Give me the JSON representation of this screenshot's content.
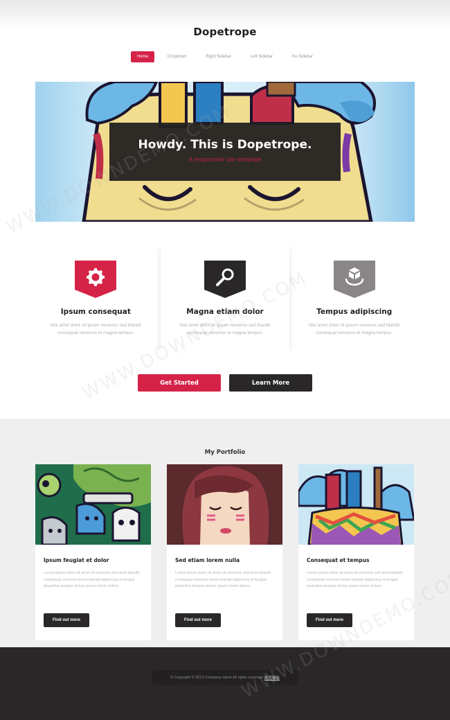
{
  "header": {
    "logo": "Dopetrope",
    "nav": [
      "Home",
      "Dropdown",
      "Right Sidebar",
      "Left Sidebar",
      "No Sidebar"
    ]
  },
  "banner": {
    "title": "Howdy. This is Dopetrope.",
    "subtitle": "A responsive site template"
  },
  "features": [
    {
      "title": "Ipsum consequat",
      "text": "Nisl amet dolor sit ipsum veroeros sed blandit consequat veroeros et magna tempus.",
      "icon": "gear-icon",
      "color": "#d52348"
    },
    {
      "title": "Magna etiam dolor",
      "text": "Nisl amet dolor sit ipsum veroeros sed blandit consequat veroeros et magna tempus.",
      "icon": "search-icon",
      "color": "#2a2728"
    },
    {
      "title": "Tempus adipiscing",
      "text": "Nisl amet dolor sit ipsum veroeros sed blandit consequat veroeros et magna tempus.",
      "icon": "cube-icon",
      "color": "#8a8586"
    }
  ],
  "cta": {
    "primary": "Get Started",
    "secondary": "Learn More"
  },
  "portfolio": {
    "title": "My Portfolio",
    "cards": [
      {
        "title": "Ipsum feugiat et dolor",
        "text": "Lorem ipsum dolor sit amet sit veroeros sed amet blandit consequat veroeros lorem blandit adipiscing et feugiat phasellus tempus dolore ipsum lorem dolore.",
        "button": "Find out more"
      },
      {
        "title": "Sed etiam lorem nulla",
        "text": "Lorem ipsum dolor sit amet sit veroeros sed amet blandit consequat veroeros lorem blandit adipiscing et feugiat phasellus tempus dolore ipsum lorem dolore.",
        "button": "Find out more"
      },
      {
        "title": "Consequat et tempus",
        "text": "Lorem ipsum dolor sit amet sit veroeros sed amet blandit consequat veroeros lorem blandit adipiscing et feugiat phasellus tempus dolore ipsum lorem dolore.",
        "button": "Find out more"
      }
    ]
  },
  "footer": {
    "copyright": "© Copyright © 2013 Company name All rights reserved",
    "link": "网页模板"
  },
  "watermark": "WWW.DOWNDEMO.COM",
  "colors": {
    "accent": "#d52348",
    "dark": "#2a2728",
    "muted": "#8a8586"
  }
}
